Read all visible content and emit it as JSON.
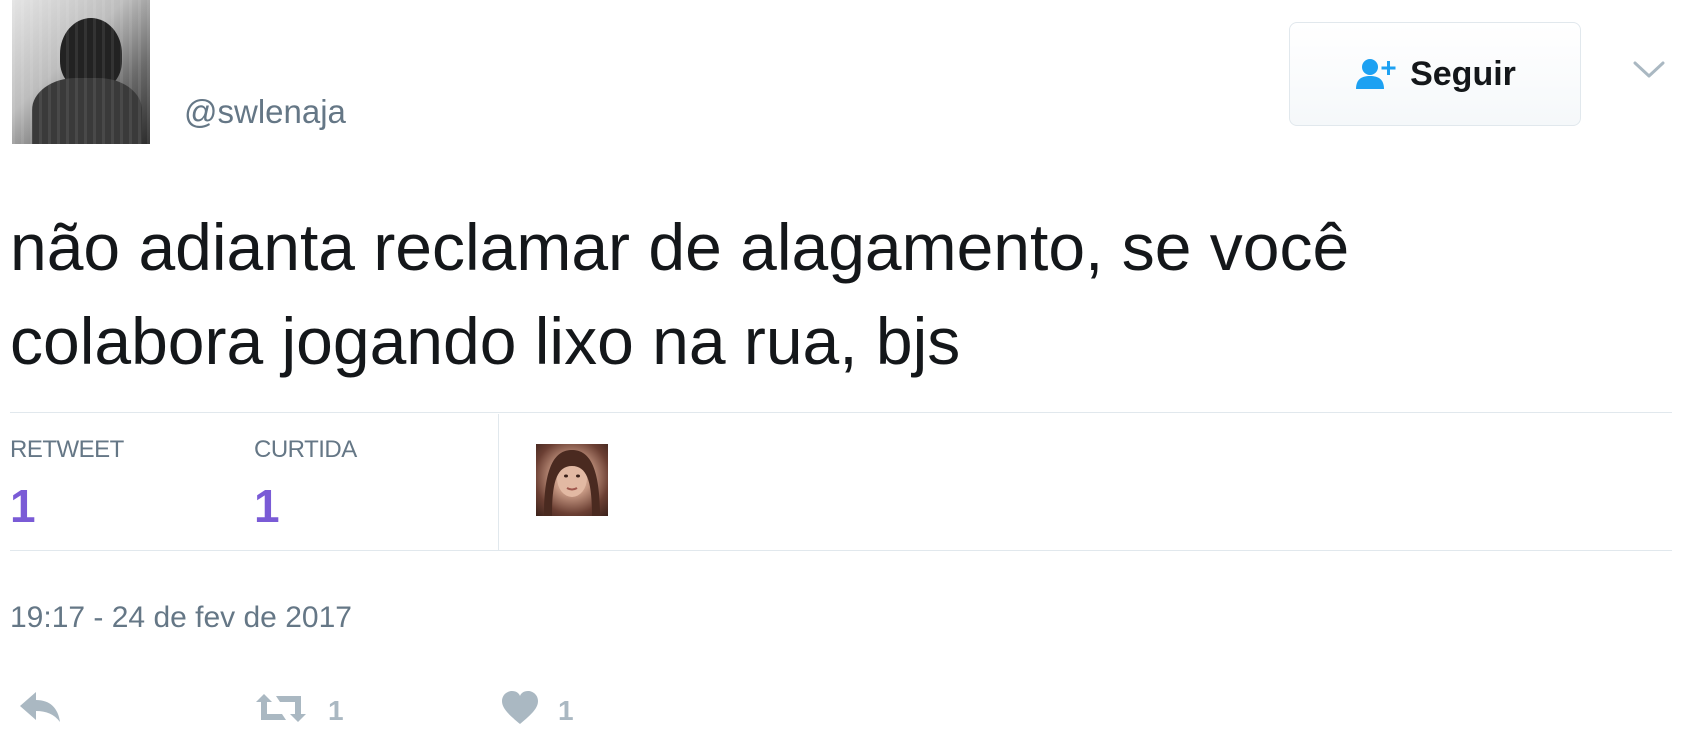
{
  "header": {
    "handle": "@swlenaja",
    "follow_label": "Seguir"
  },
  "tweet": {
    "text": "não adianta reclamar de alagamento, se você colabora jogando lixo na rua, bjs",
    "timestamp": "19:17 - 24 de fev de 2017"
  },
  "stats": [
    {
      "label": "RETWEET",
      "value": "1"
    },
    {
      "label": "CURTIDA",
      "value": "1"
    }
  ],
  "actions": {
    "retweet_count": "1",
    "like_count": "1"
  },
  "colors": {
    "accent": "#1da1f2",
    "stat_value": "#7a5bd6",
    "muted": "#657786",
    "action_icon": "#aab8c2"
  },
  "icons": {
    "follow": "follow-user-icon",
    "caret": "chevron-down-icon",
    "reply": "reply-icon",
    "retweet": "retweet-icon",
    "like": "heart-icon"
  }
}
